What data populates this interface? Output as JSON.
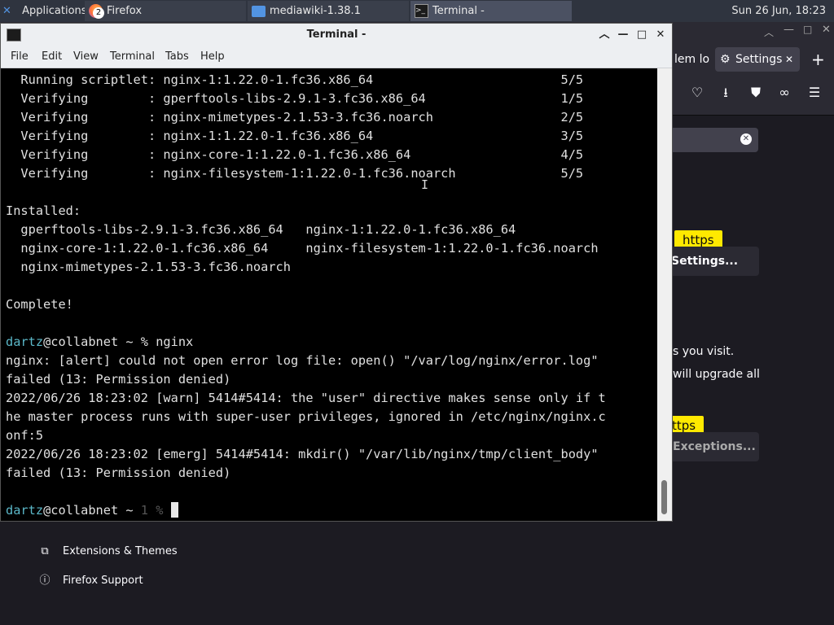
{
  "panel": {
    "apps_label": "Applications",
    "tasks": [
      {
        "label": "Firefox",
        "badge": "2"
      },
      {
        "label": "mediawiki-1.38.1"
      },
      {
        "label": "Terminal -"
      }
    ],
    "clock": "Sun 26 Jun, 18:23"
  },
  "firefox": {
    "tab_partial": "lem lo",
    "settings_tab": "Settings",
    "button1_partial": "Settings...",
    "tooltip1": "https",
    "text1": "s you visit.",
    "text2": "will upgrade all",
    "tooltip2": "ttps",
    "button2_partial": "Exceptions...",
    "footer": [
      {
        "label": "Extensions & Themes",
        "icon": "puzzle-icon"
      },
      {
        "label": "Firefox Support",
        "icon": "help-icon"
      }
    ]
  },
  "terminal": {
    "title": "Terminal -",
    "menu": [
      "File",
      "Edit",
      "View",
      "Terminal",
      "Tabs",
      "Help"
    ],
    "lines": [
      "  Running scriptlet: nginx-1:1.22.0-1.fc36.x86_64                         5/5",
      "  Verifying        : gperftools-libs-2.9.1-3.fc36.x86_64                  1/5",
      "  Verifying        : nginx-mimetypes-2.1.53-3.fc36.noarch                 2/5",
      "  Verifying        : nginx-1:1.22.0-1.fc36.x86_64                         3/5",
      "  Verifying        : nginx-core-1:1.22.0-1.fc36.x86_64                    4/5",
      "  Verifying        : nginx-filesystem-1:1.22.0-1.fc36.noarch              5/5",
      "",
      "Installed:",
      "  gperftools-libs-2.9.1-3.fc36.x86_64   nginx-1:1.22.0-1.fc36.x86_64",
      "  nginx-core-1:1.22.0-1.fc36.x86_64     nginx-filesystem-1:1.22.0-1.fc36.noarch",
      "  nginx-mimetypes-2.1.53-3.fc36.noarch",
      "",
      "Complete!",
      "",
      "nginx: [alert] could not open error log file: open() \"/var/log/nginx/error.log\"",
      "failed (13: Permission denied)",
      "2022/06/26 18:23:02 [warn] 5414#5414: the \"user\" directive makes sense only if t",
      "he master process runs with super-user privileges, ignored in /etc/nginx/nginx.c",
      "onf:5",
      "2022/06/26 18:23:02 [emerg] 5414#5414: mkdir() \"/var/lib/nginx/tmp/client_body\"",
      "failed (13: Permission denied)",
      ""
    ],
    "prompt_user": "dartz",
    "prompt_host": "@collabnet ~ ",
    "prompt1_symbol": "% ",
    "prompt1_command": "nginx",
    "prompt2_status": "1 % ",
    "colors": {
      "user": "#5bb8c9",
      "background": "#000000",
      "text": "#e0e0e0"
    }
  }
}
